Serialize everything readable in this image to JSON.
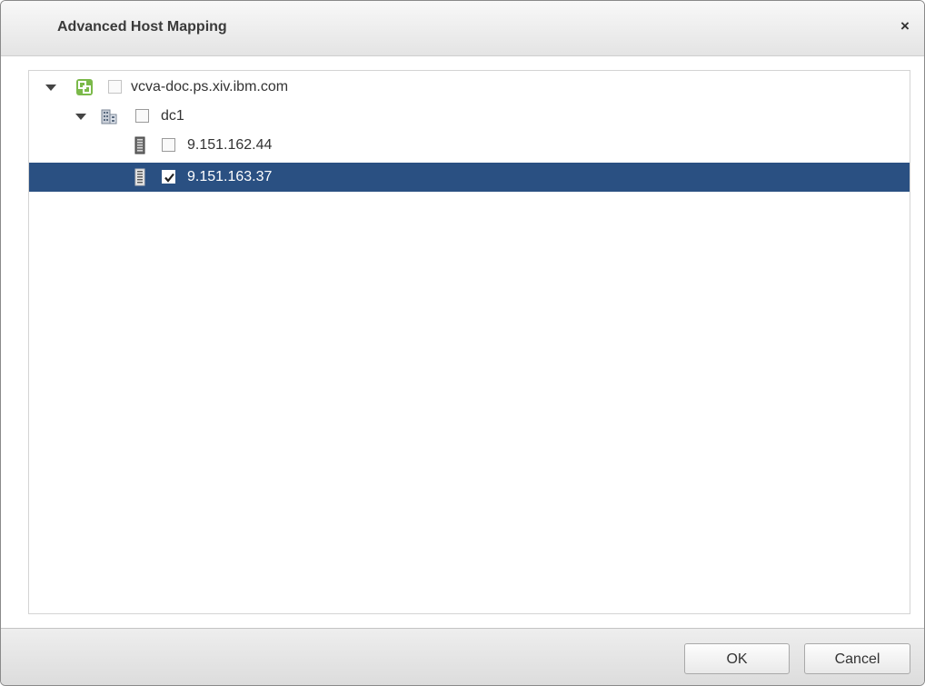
{
  "dialog": {
    "title": "Advanced Host Mapping",
    "close_glyph": "×"
  },
  "tree": {
    "nodes": [
      {
        "label": "vcva-doc.ps.xiv.ibm.com",
        "icon": "vcenter-icon",
        "expanded": true,
        "checked": false
      },
      {
        "label": "dc1",
        "icon": "datacenter-icon",
        "expanded": true,
        "checked": false
      },
      {
        "label": "9.151.162.44",
        "icon": "host-icon",
        "checked": false
      },
      {
        "label": "9.151.163.37",
        "icon": "host-icon",
        "checked": true,
        "selected": true
      }
    ]
  },
  "footer": {
    "ok_label": "OK",
    "cancel_label": "Cancel"
  },
  "colors": {
    "selection": "#2a5082",
    "vcenter_icon": "#7bb94a"
  }
}
